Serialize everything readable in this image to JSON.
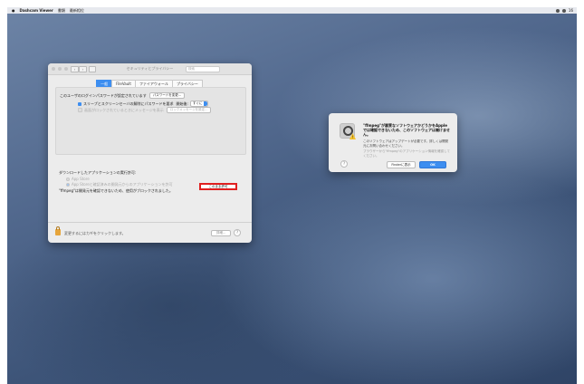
{
  "menubar": {
    "apple": "",
    "app_name": "Dashcam Viewer",
    "items": [
      "書類",
      "最新相位"
    ],
    "right_text": "16"
  },
  "security_window": {
    "title": "セキュリティとプライバシー",
    "search_placeholder": "検索",
    "tabs": [
      "一般",
      "FileVault",
      "ファイアウォール",
      "プライバシー"
    ],
    "active_tab": "一般",
    "login_password_text": "このユーザのログインパスワードが設定されています",
    "change_password_button": "パスワードを変更...",
    "require_password_text": "スリープとスクリーンセーバの解除にパスワードを要求",
    "start_label": "開始後:",
    "delay_value": "すぐに",
    "lock_message_text": "画面がロックされているときにメッセージを表示",
    "lock_message_button": "ロックメッセージを設定...",
    "download_heading": "ダウンロードしたアプリケーションの実行許可:",
    "option_app_store": "App Store",
    "option_identified": "App Storeと確認済みの開発元からのアプリケーションを許可",
    "blocked_text": "\"ffmpeg\"は開発元を確認できないため、使用がブロックされました。",
    "allow_button": "このまま許可",
    "footer_text": "変更するにはカギをクリックします。",
    "advanced_button": "詳細...",
    "help": "?"
  },
  "alert": {
    "title": "\"ffmpeg\"が悪質なソフトウェアかどうかをAppleでは確認できないため、このソフトウェアは開けません。",
    "body": "このソフトウェアはアップデートが必要です。詳しくは開発元にお問い合わせください。",
    "note": "ブラウザーから\"ffmpeg\"のアプリケーション情報を確認してください。",
    "help": "?",
    "finder_button": "Finderに表示",
    "ok_button": "OK",
    "badge": "!"
  },
  "colors": {
    "accent": "#3d8ef0",
    "highlight_box": "#e02020",
    "wallpaper": "#4a6388"
  }
}
